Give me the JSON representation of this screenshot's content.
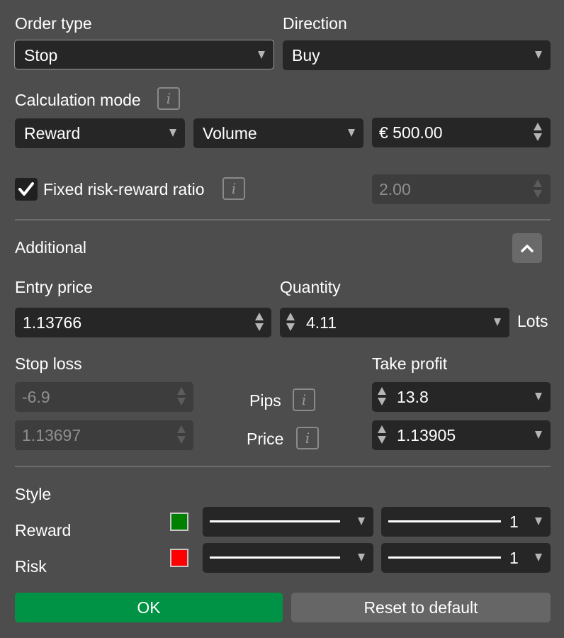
{
  "order_type": {
    "label": "Order type",
    "value": "Stop"
  },
  "direction": {
    "label": "Direction",
    "value": "Buy"
  },
  "calculation_mode": {
    "label": "Calculation mode",
    "info": "i",
    "mode_value": "Reward",
    "unit_value": "Volume",
    "amount_value": "€ 500.00"
  },
  "fixed_ratio": {
    "label": "Fixed risk-reward ratio",
    "checked": true,
    "info": "i",
    "value": "2.00"
  },
  "additional": {
    "title": "Additional",
    "collapse_icon": "chevron-up-icon"
  },
  "entry_price": {
    "label": "Entry price",
    "value": "1.13766"
  },
  "quantity": {
    "label": "Quantity",
    "value": "4.11",
    "unit": "Lots"
  },
  "stop_loss": {
    "label": "Stop loss",
    "pips_value": "-6.9",
    "price_value": "1.13697"
  },
  "take_profit": {
    "label": "Take profit",
    "pips_value": "13.8",
    "price_value": "1.13905"
  },
  "row_labels": {
    "pips": "Pips",
    "price": "Price",
    "info": "i"
  },
  "style": {
    "title": "Style",
    "reward": {
      "label": "Reward",
      "color": "#008000",
      "width": "1"
    },
    "risk": {
      "label": "Risk",
      "color": "#ff0000",
      "width": "1"
    }
  },
  "buttons": {
    "ok": "OK",
    "reset": "Reset to default"
  },
  "colors": {
    "background": "#4d4d4d",
    "field": "#262626",
    "ok": "#009245",
    "reset": "#666666"
  }
}
